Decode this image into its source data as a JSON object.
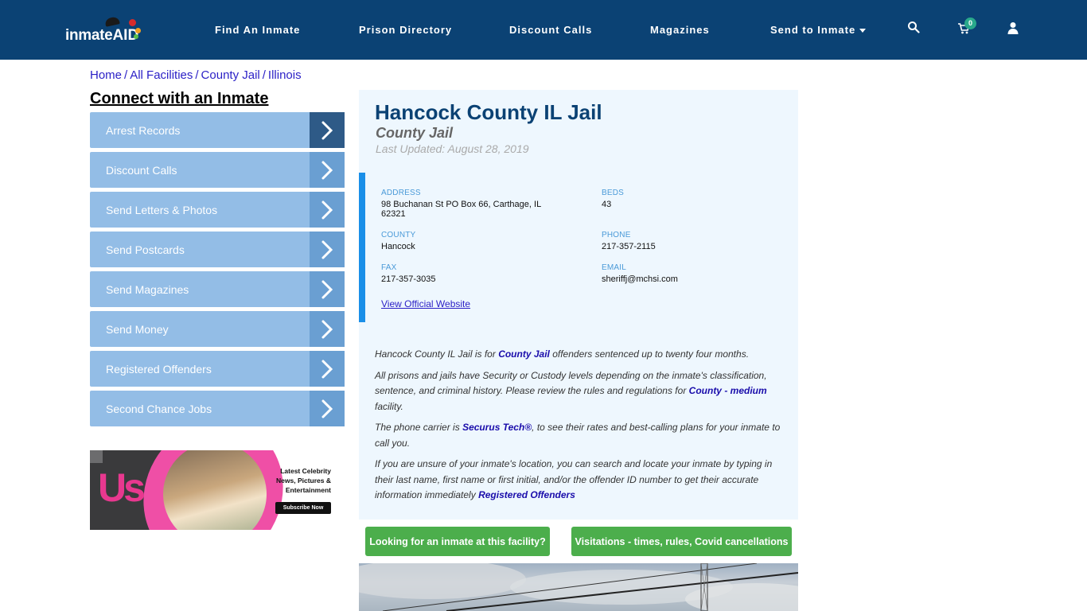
{
  "header": {
    "logo_text": "inmate",
    "logo_accent": "AID",
    "nav": [
      {
        "label": "Find An Inmate"
      },
      {
        "label": "Prison Directory"
      },
      {
        "label": "Discount Calls"
      },
      {
        "label": "Magazines"
      },
      {
        "label": "Send to Inmate"
      }
    ],
    "icons": [
      "search-icon",
      "cart-icon",
      "user-icon"
    ],
    "cart_count": "0",
    "brand_color": "#0b4274"
  },
  "breadcrumb": [
    {
      "label": "Home"
    },
    {
      "label": "All Facilities"
    },
    {
      "label": "County Jail"
    },
    {
      "label": "Illinois"
    }
  ],
  "sidebar": {
    "title": "Connect with an Inmate",
    "items": [
      {
        "label": "Arrest Records"
      },
      {
        "label": "Discount Calls"
      },
      {
        "label": "Send Letters & Photos"
      },
      {
        "label": "Send Postcards"
      },
      {
        "label": "Send Magazines"
      },
      {
        "label": "Send Money"
      },
      {
        "label": "Registered Offenders"
      },
      {
        "label": "Second Chance Jobs"
      }
    ],
    "ad": {
      "brand": "Us",
      "headline_lines": [
        "Latest Celebrity",
        "News, Pictures &",
        "Entertainment"
      ],
      "cta": "Subscribe Now"
    }
  },
  "facility": {
    "name": "Hancock County IL Jail",
    "type": "County Jail",
    "last_updated": "Last Updated: August 28, 2019",
    "fields": {
      "address": {
        "label": "ADDRESS",
        "value": "98 Buchanan St PO Box 66, Carthage, IL 62321"
      },
      "beds": {
        "label": "BEDS",
        "value": "43"
      },
      "county": {
        "label": "COUNTY",
        "value": "Hancock"
      },
      "phone": {
        "label": "PHONE",
        "value": "217-357-2115"
      },
      "fax": {
        "label": "FAX",
        "value": "217-357-3035"
      },
      "email": {
        "label": "EMAIL",
        "value": "sheriffj@mchsi.com"
      }
    },
    "website_link": "View Official Website"
  },
  "description": {
    "p1_pre": "Hancock County IL Jail is for ",
    "p1_link": "County Jail",
    "p1_post": " offenders sentenced up to twenty four months.",
    "p2_pre": "All prisons and jails have Security or Custody levels depending on the inmate's classification, sentence, and criminal history. Please review the rules and regulations for ",
    "p2_link": "County - medium",
    "p2_post": " facility.",
    "p3_pre": "The phone carrier is ",
    "p3_link": "Securus Tech®",
    "p3_post": ", to see their rates and best-calling plans for your inmate to call you.",
    "p4_pre": "If you are unsure of your inmate's location, you can search and locate your inmate by typing in their last name, first name or first initial, and/or the offender ID number to get their accurate information immediately ",
    "p4_link": "Registered Offenders"
  },
  "buttons": {
    "find_inmate": "Looking for an inmate at this facility?",
    "visitations": "Visitations - times, rules, Covid cancellations",
    "color": "#4cae4c"
  }
}
